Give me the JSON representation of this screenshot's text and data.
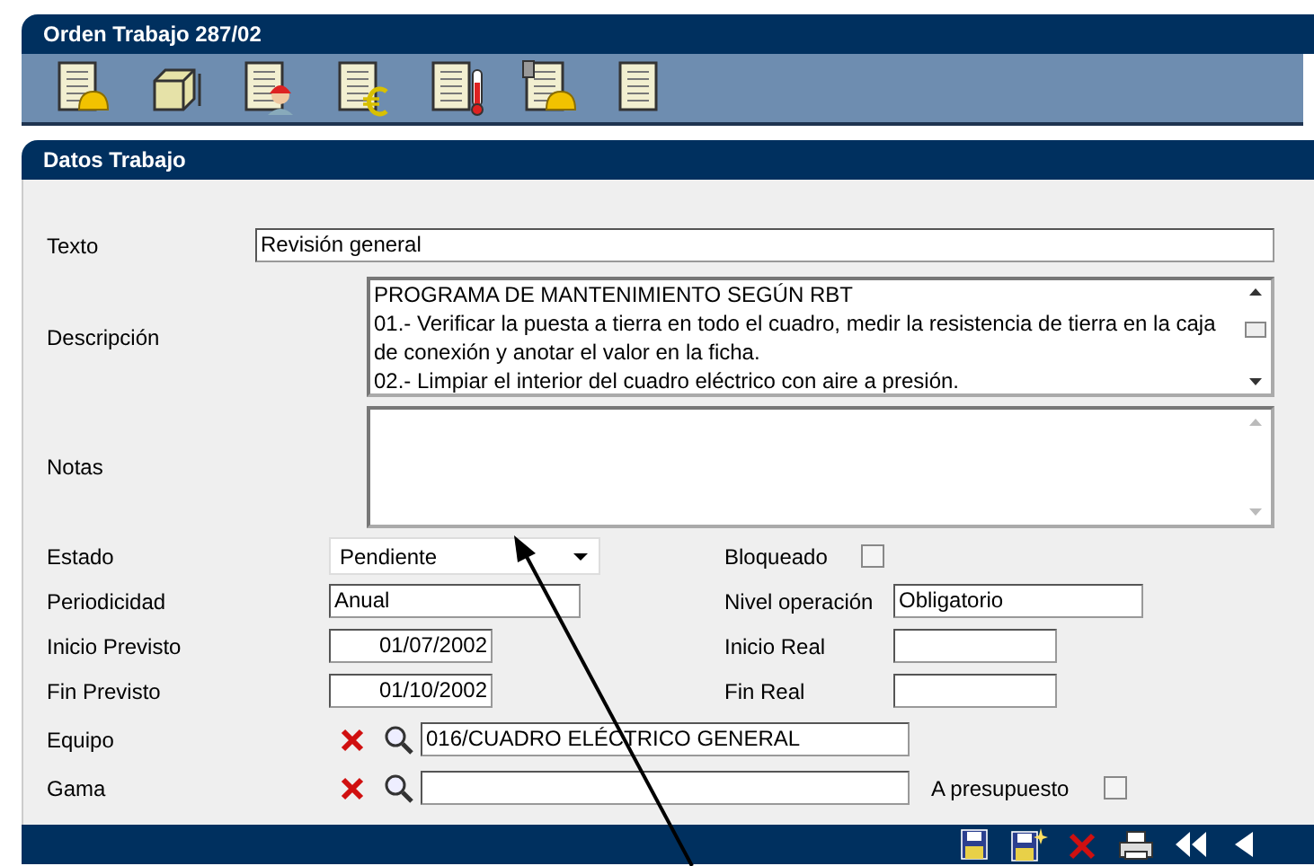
{
  "window": {
    "title": "Orden Trabajo 287/02"
  },
  "toolbar": [
    {
      "kind": "helmet-doc"
    },
    {
      "kind": "cube"
    },
    {
      "kind": "worker-doc"
    },
    {
      "kind": "euro-doc"
    },
    {
      "kind": "thermo-doc"
    },
    {
      "kind": "plug-helmet-doc"
    },
    {
      "kind": "doc"
    }
  ],
  "section": {
    "title": "Datos Trabajo"
  },
  "texto": {
    "label": "Texto",
    "value": "Revisión general"
  },
  "descripcion": {
    "label": "Descripción",
    "value": "PROGRAMA DE MANTENIMIENTO SEGÚN RBT\n01.- Verificar la puesta a tierra en todo el cuadro, medir la resistencia de tierra en la caja de conexión y anotar el valor en la ficha.\n02.- Limpiar el interior del cuadro eléctrico con aire a presión."
  },
  "notas": {
    "label": "Notas"
  },
  "estado": {
    "label": "Estado",
    "value": "Pendiente"
  },
  "bloqueado": {
    "label": "Bloqueado",
    "checked": false
  },
  "periodicidad": {
    "label": "Periodicidad",
    "value": "Anual"
  },
  "nivel_operacion": {
    "label": "Nivel operación",
    "value": "Obligatorio"
  },
  "inicio_previsto": {
    "label": "Inicio Previsto",
    "value": "01/07/2002"
  },
  "inicio_real": {
    "label": "Inicio Real"
  },
  "fin_previsto": {
    "label": "Fin Previsto",
    "value": "01/10/2002"
  },
  "fin_real": {
    "label": "Fin Real"
  },
  "equipo": {
    "label": "Equipo",
    "value": "016/CUADRO ELÉCTRICO GENERAL"
  },
  "gama": {
    "label": "Gama"
  },
  "a_presupuesto": {
    "label": "A presupuesto",
    "checked": false
  },
  "footer": [
    {
      "kind": "save"
    },
    {
      "kind": "save-new"
    },
    {
      "kind": "delete"
    },
    {
      "kind": "print"
    },
    {
      "kind": "first"
    },
    {
      "kind": "previous"
    }
  ],
  "annotation": {
    "kind": "arrow"
  }
}
